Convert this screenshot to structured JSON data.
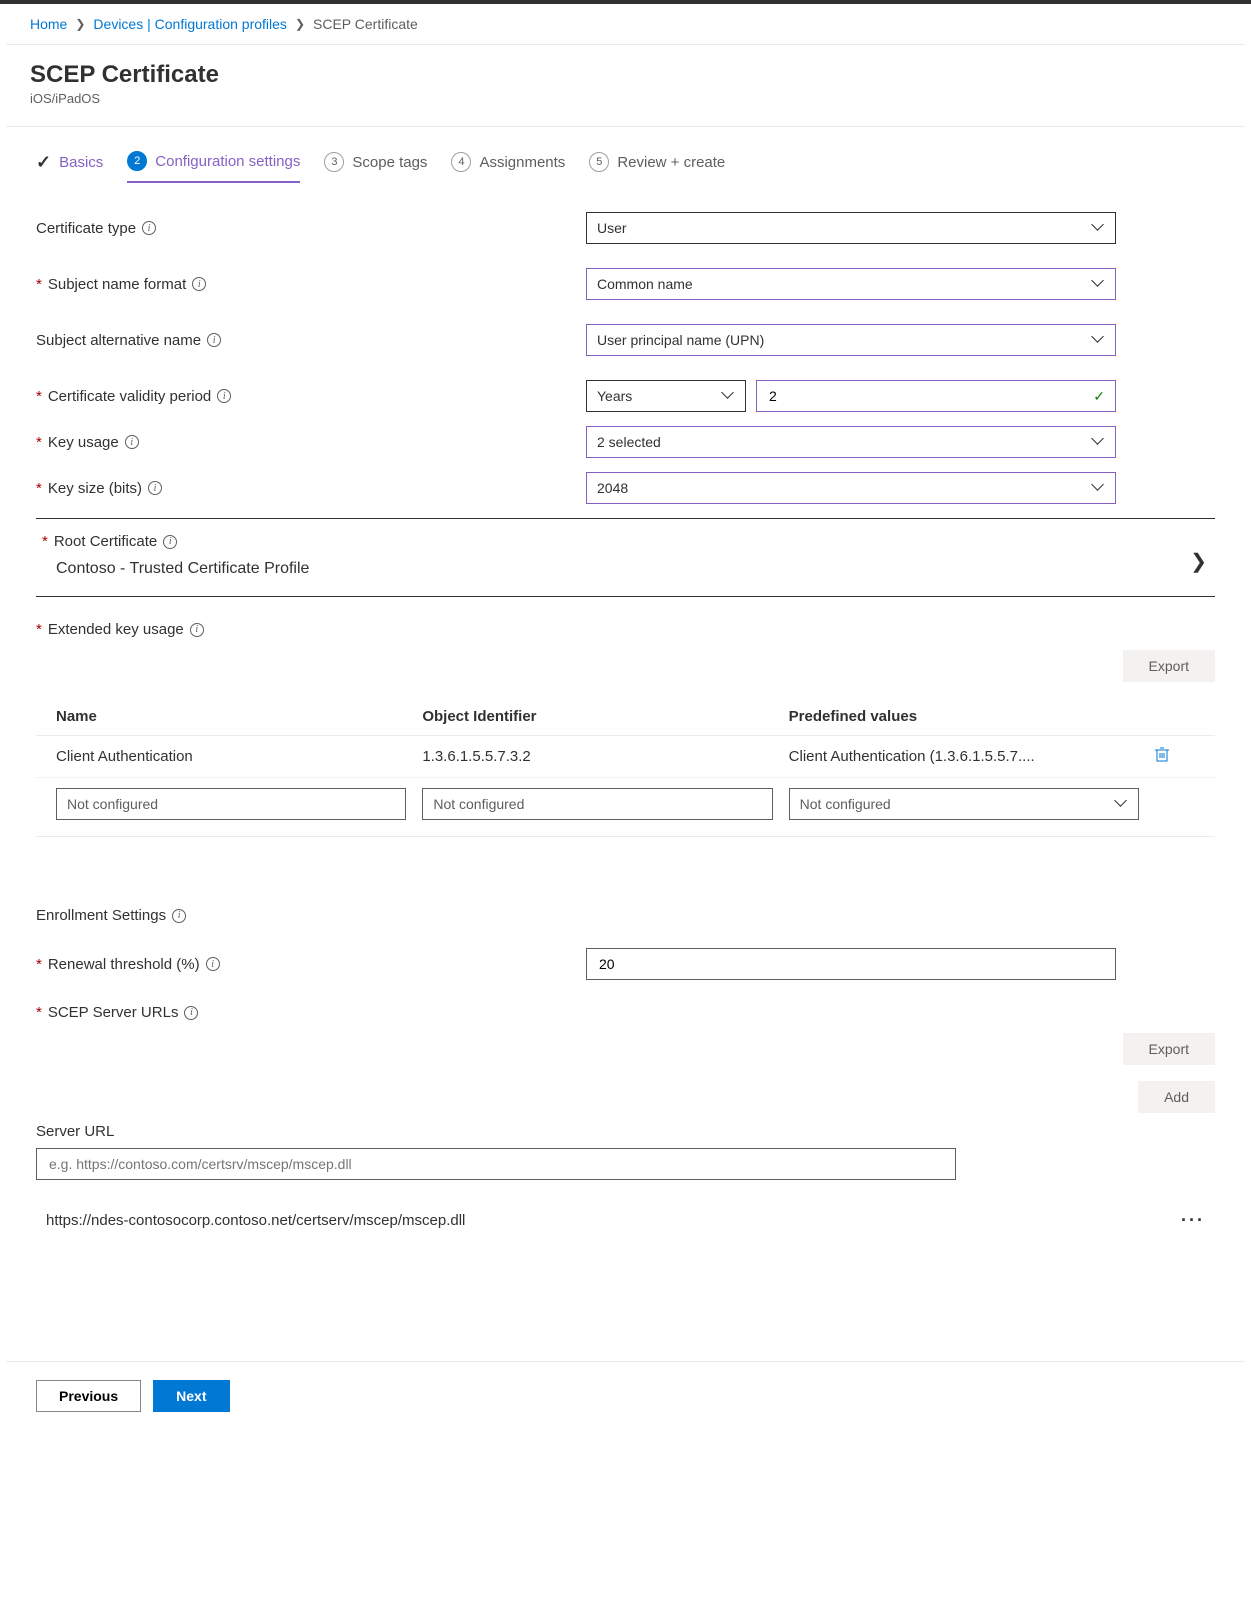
{
  "breadcrumb": {
    "home": "Home",
    "devices": "Devices | Configuration profiles",
    "current": "SCEP Certificate"
  },
  "header": {
    "title": "SCEP Certificate",
    "subtitle": "iOS/iPadOS"
  },
  "steps": {
    "s1": "Basics",
    "s2": "Configuration settings",
    "s3": "Scope tags",
    "s4": "Assignments",
    "s5": "Review + create",
    "n3": "3",
    "n4": "4",
    "n5": "5",
    "n2": "2"
  },
  "fields": {
    "certType": {
      "label": "Certificate type",
      "value": "User"
    },
    "subjectName": {
      "label": "Subject name format",
      "value": "Common name"
    },
    "san": {
      "label": "Subject alternative name",
      "value": "User principal name (UPN)"
    },
    "validity": {
      "label": "Certificate validity period",
      "unit": "Years",
      "value": "2"
    },
    "keyUsage": {
      "label": "Key usage",
      "value": "2 selected"
    },
    "keySize": {
      "label": "Key size (bits)",
      "value": "2048"
    },
    "rootCert": {
      "label": "Root Certificate",
      "value": "Contoso - Trusted Certificate Profile"
    },
    "eku": {
      "label": "Extended key usage"
    },
    "renewal": {
      "label": "Renewal threshold (%)",
      "value": "20"
    },
    "scepUrls": {
      "label": "SCEP Server URLs"
    }
  },
  "buttons": {
    "export": "Export",
    "add": "Add",
    "previous": "Previous",
    "next": "Next"
  },
  "ekuTable": {
    "h1": "Name",
    "h2": "Object Identifier",
    "h3": "Predefined values",
    "r1c1": "Client Authentication",
    "r1c2": "1.3.6.1.5.5.7.3.2",
    "r1c3": "Client Authentication (1.3.6.1.5.5.7....",
    "placeholder": "Not configured"
  },
  "enrollment": {
    "heading": "Enrollment Settings",
    "serverUrlLabel": "Server URL",
    "serverUrlPlaceholder": "e.g. https://contoso.com/certsrv/mscep/mscep.dll",
    "serverUrlValue": "https://ndes-contosocorp.contoso.net/certserv/mscep/mscep.dll"
  }
}
